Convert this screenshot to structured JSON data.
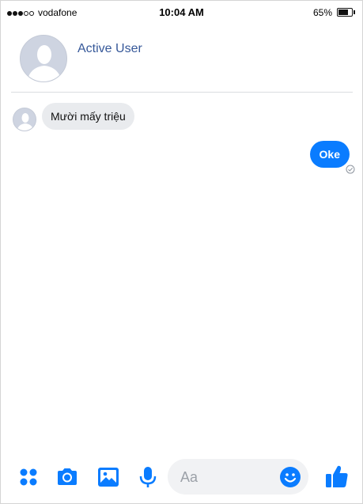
{
  "status_bar": {
    "carrier": "vodafone",
    "time": "10:04 AM",
    "battery": "65%"
  },
  "header": {
    "name": "Active User"
  },
  "messages": [
    {
      "direction": "incoming",
      "text": "Mười mấy triệu"
    },
    {
      "direction": "outgoing",
      "text": "Oke"
    }
  ],
  "composer": {
    "placeholder": "Aa",
    "tools": [
      "grid-icon",
      "camera-icon",
      "image-icon",
      "microphone-icon"
    ],
    "emoji_icon": "smiley-icon",
    "send_icon": "thumbs-up-icon"
  },
  "colors": {
    "accent": "#0a7cff",
    "name_link": "#365899",
    "incoming_bubble": "#e9ebee",
    "input_bg": "#f1f2f4"
  }
}
